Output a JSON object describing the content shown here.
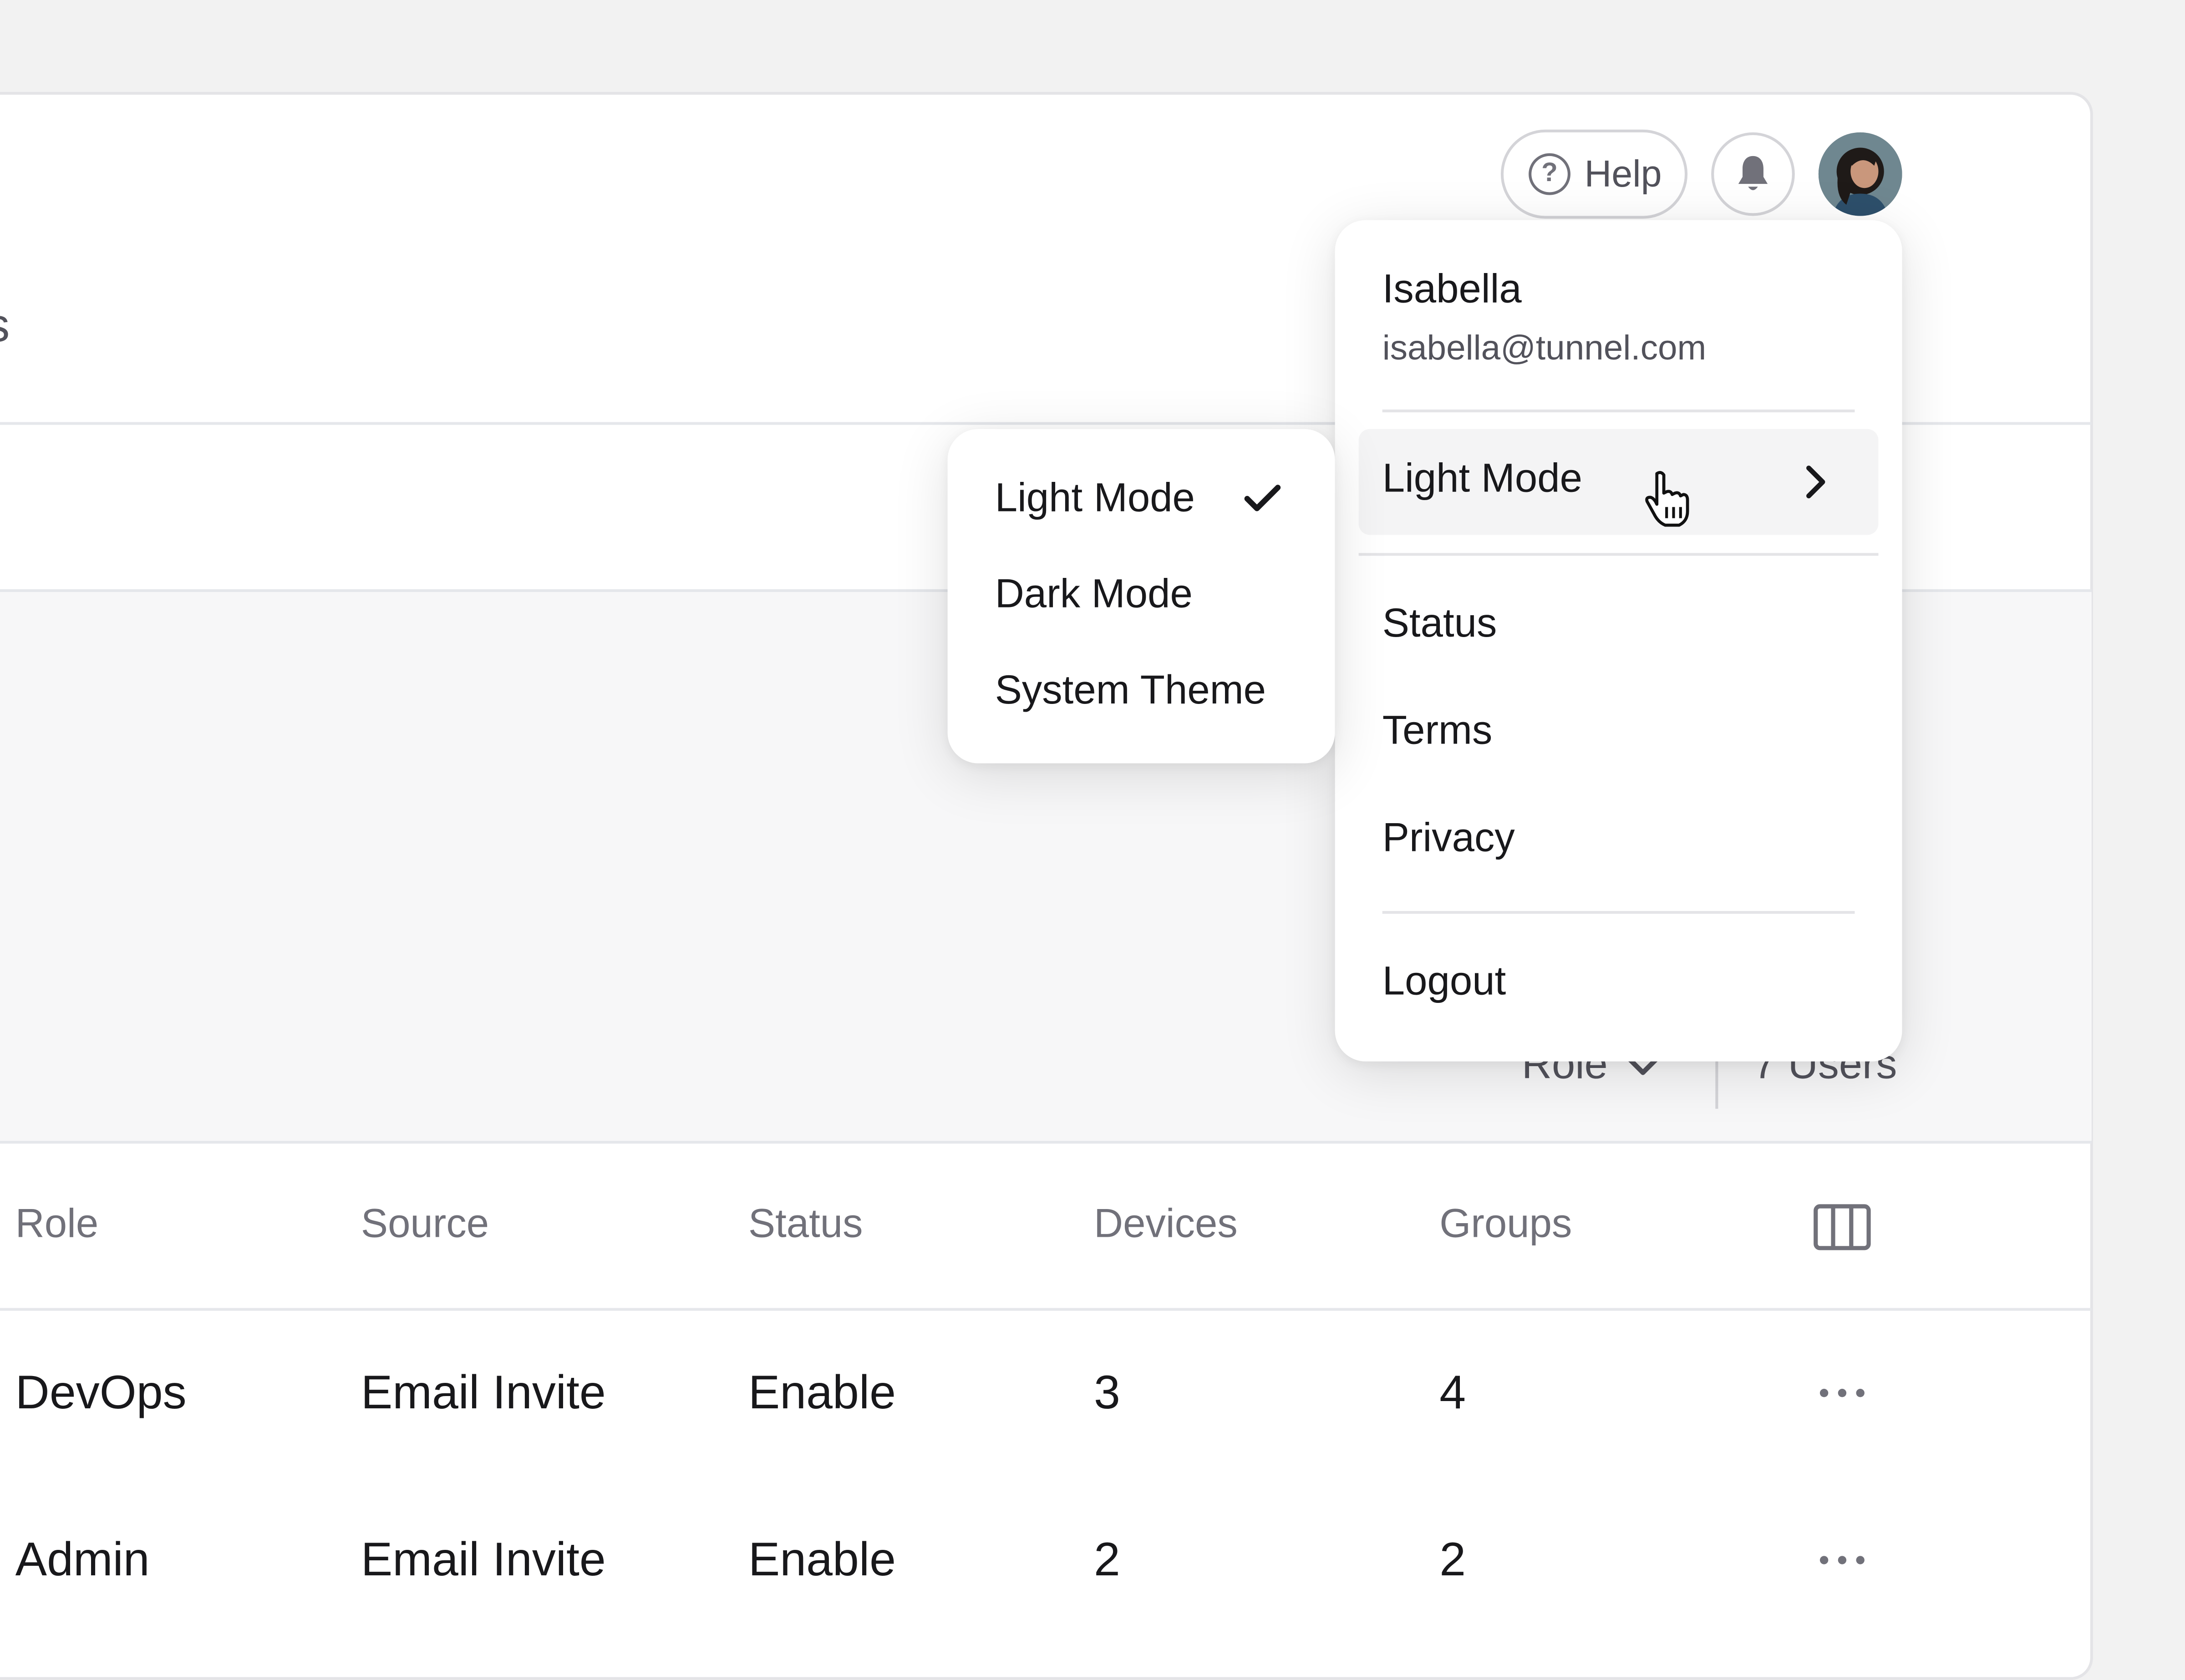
{
  "header": {
    "help_label": "Help",
    "partial_title": "s"
  },
  "filters": {
    "role_label": "Role",
    "users_count": "7 Users"
  },
  "table": {
    "columns": [
      "Role",
      "Source",
      "Status",
      "Devices",
      "Groups"
    ],
    "rows": [
      {
        "role": "DevOps",
        "source": "Email Invite",
        "status": "Enable",
        "devices": "3",
        "groups": "4"
      },
      {
        "role": "Admin",
        "source": "Email Invite",
        "status": "Enable",
        "devices": "2",
        "groups": "2"
      }
    ]
  },
  "user_menu": {
    "name": "Isabella",
    "email": "isabella@tunnel.com",
    "theme_item": "Light Mode",
    "items": [
      "Status",
      "Terms",
      "Privacy"
    ],
    "logout": "Logout"
  },
  "theme_submenu": {
    "options": [
      "Light Mode",
      "Dark Mode",
      "System Theme"
    ],
    "selected": "Light Mode"
  },
  "icons": {
    "help": "question-circle-icon",
    "notifications": "bell-icon",
    "submenu_arrow": "chevron-right-icon",
    "filter_dropdown": "chevron-down-icon",
    "columns": "columns-icon",
    "row_actions": "more-horizontal-icon",
    "checkmark": "check-icon",
    "cursor": "hand-pointer-icon"
  }
}
